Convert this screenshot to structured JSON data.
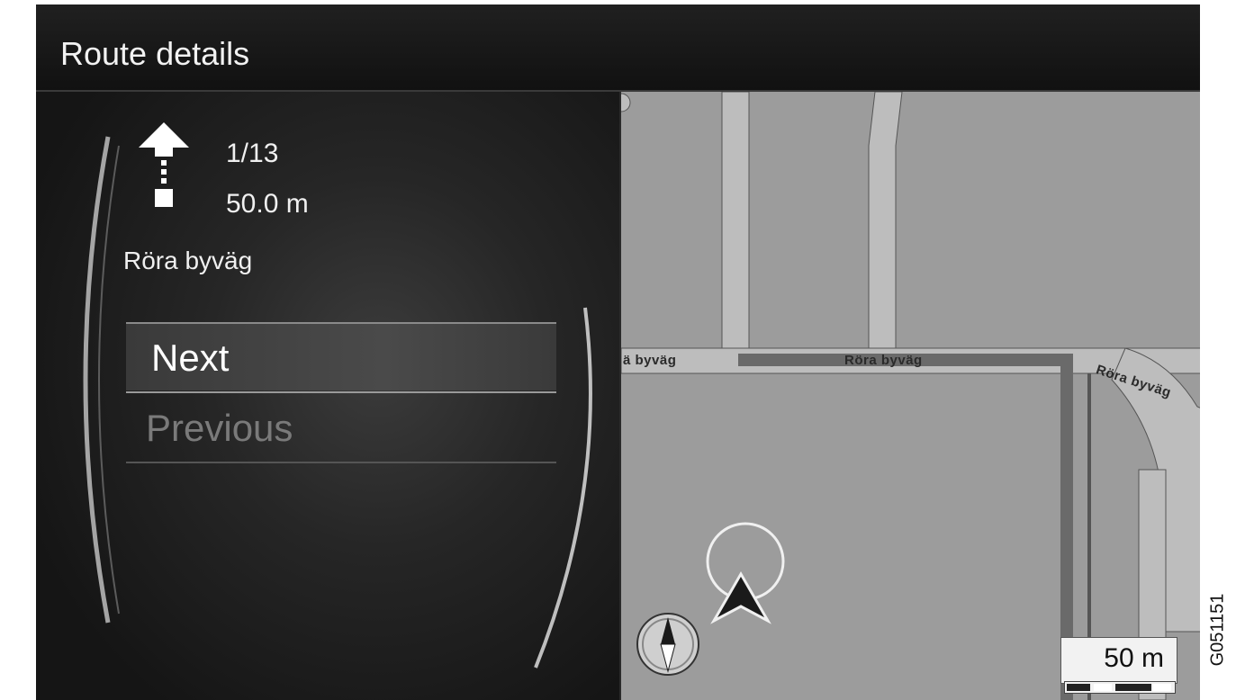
{
  "header": {
    "title": "Route details"
  },
  "guidance": {
    "maneuver_icon": "straight-arrow-icon",
    "step": "1/13",
    "distance": "50.0 m",
    "street": "Röra byväg"
  },
  "menu": {
    "next_label": "Next",
    "previous_label": "Previous"
  },
  "map": {
    "street_label_left": "ä byväg",
    "street_label_center": "Röra byväg",
    "street_label_right": "Röra byväg",
    "scale": "50 m",
    "vehicle_icon": "vehicle-position-icon",
    "compass_icon": "compass-icon"
  },
  "image_code": "G051151",
  "colors": {
    "header_bg": "#161616",
    "menu_highlight": "#4a4a4a",
    "map_bg": "#9c9c9c",
    "road": "#bdbdbd",
    "route": "#6a6a6a"
  }
}
